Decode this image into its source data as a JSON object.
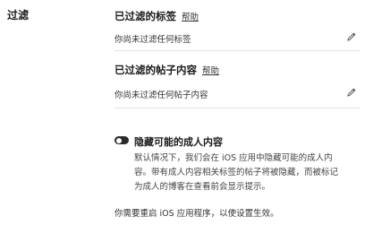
{
  "section": {
    "label": "过滤"
  },
  "filtered_tags": {
    "title": "已过滤的标签",
    "help_label": "帮助",
    "value": "你尚未过滤任何标签"
  },
  "filtered_posts": {
    "title": "已过滤的帖子内容",
    "help_label": "帮助",
    "value": "你尚未过滤任何帖子内容"
  },
  "adult_content": {
    "toggle_label": "隐藏可能的成人内容",
    "toggle_state": "off",
    "description_lines": [
      "默认情况下，我们会在 iOS 应用中隐藏可能的成人内",
      "容。带有成人内容相关标签的帖子将被隐藏，而被标记",
      "为成人的博客在查看前会显示提示。"
    ]
  },
  "footer_note": "你需要重启 iOS 应用程序，以使设置生效。",
  "icons": {
    "edit": "pencil-icon"
  }
}
